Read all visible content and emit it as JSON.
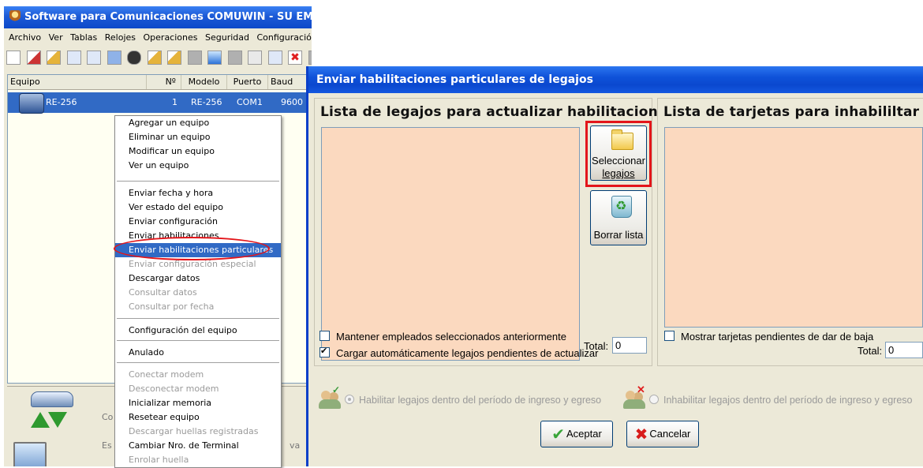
{
  "main_window": {
    "title": "Software para Comunicaciones COMUWIN - SU EMPRESA S",
    "menu": [
      "Archivo",
      "Ver",
      "Tablas",
      "Relojes",
      "Operaciones",
      "Seguridad",
      "Configuración"
    ],
    "list_headers": {
      "equipo": "Equipo",
      "numero": "Nº",
      "modelo": "Modelo",
      "puerto": "Puerto",
      "baud": "Baud"
    },
    "device": {
      "name": "RE-256",
      "numero": "1",
      "modelo": "RE-256",
      "puerto": "COM1",
      "baud": "9600"
    },
    "bottom_labels": {
      "con": "Co",
      "est": "Es",
      "va": "va"
    }
  },
  "context_menu": {
    "items": [
      {
        "label": "Agregar un equipo",
        "enabled": true
      },
      {
        "label": "Eliminar un equipo",
        "enabled": true
      },
      {
        "label": "Modificar un equipo",
        "enabled": true
      },
      {
        "label": "Ver un equipo",
        "enabled": true
      },
      {
        "label": "Enviar fecha y hora",
        "enabled": true
      },
      {
        "label": "Ver estado del equipo",
        "enabled": true
      },
      {
        "label": "Enviar configuración",
        "enabled": true
      },
      {
        "label": "Enviar habilitaciones",
        "enabled": true
      },
      {
        "label": "Enviar habilitaciones particulares",
        "enabled": true,
        "highlighted": true
      },
      {
        "label": "Enviar configuración especial",
        "enabled": false
      },
      {
        "label": "Descargar datos",
        "enabled": true
      },
      {
        "label": "Consultar datos",
        "enabled": false
      },
      {
        "label": "Consultar por fecha",
        "enabled": false
      },
      {
        "label": "Configuración del equipo",
        "enabled": true
      },
      {
        "label": "Anulado",
        "enabled": true
      },
      {
        "label": "Conectar modem",
        "enabled": false
      },
      {
        "label": "Desconectar modem",
        "enabled": false
      },
      {
        "label": "Inicializar memoria",
        "enabled": true
      },
      {
        "label": "Resetear equipo",
        "enabled": true
      },
      {
        "label": "Descargar huellas registradas",
        "enabled": false
      },
      {
        "label": "Cambiar Nro. de Terminal",
        "enabled": true
      },
      {
        "label": "Enrolar huella",
        "enabled": false
      }
    ]
  },
  "dialog": {
    "title": "Enviar habilitaciones particulares de legajos",
    "left_group": {
      "title": "Lista de legajos para actualizar habilitaciones",
      "select_button": {
        "line1": "Seleccionar",
        "line2": "legajos"
      },
      "clear_button": "Borrar lista",
      "total_label": "Total:",
      "total_value": "0",
      "check_keep": {
        "label": "Mantener empleados seleccionados anteriormente",
        "checked": false
      },
      "check_autoload": {
        "label": "Cargar automáticamente legajos pendientes de actualizar",
        "checked": true
      }
    },
    "right_group": {
      "title": "Lista de tarjetas para inhabililtar",
      "check_pending": {
        "label": "Mostrar tarjetas pendientes de dar de baja",
        "checked": false
      },
      "total_label": "Total:",
      "total_value": "0"
    },
    "options": {
      "enable": {
        "label": "Habilitar legajos dentro del período de ingreso y egreso",
        "selected": true
      },
      "disable": {
        "label": "Inhabilitar legajos dentro del período de ingreso y egreso",
        "selected": false
      }
    },
    "accept_button": "Aceptar",
    "cancel_button": "Cancelar"
  },
  "colors": {
    "listbox_bg": "#fbd9bf",
    "selection": "#316ac5",
    "annotation_red": "#e3151a",
    "xp_title_blue": "#0a48cf"
  }
}
